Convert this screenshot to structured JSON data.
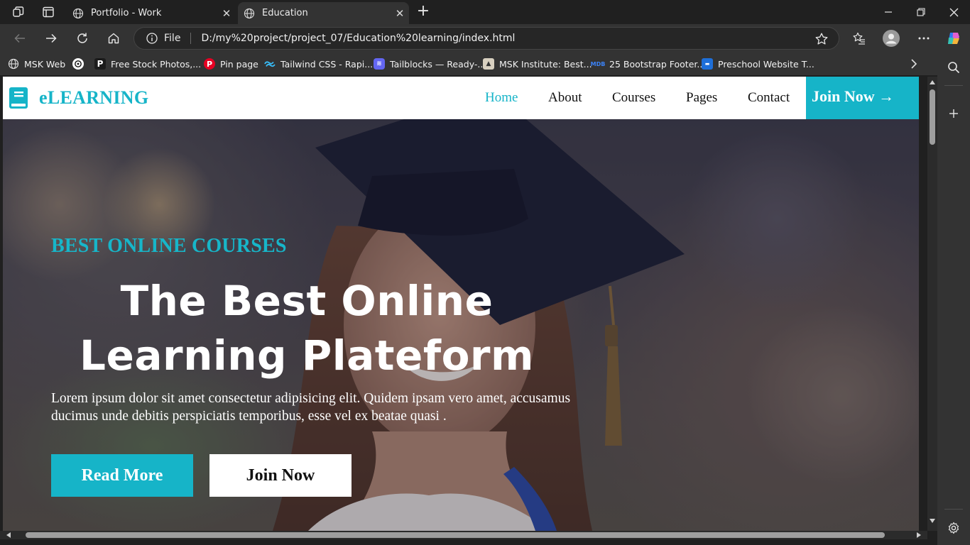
{
  "browser": {
    "tabs": [
      {
        "title": "Portfolio - Work",
        "icon": "globe-icon",
        "active": false
      },
      {
        "title": "Education",
        "icon": "globe-icon",
        "active": true
      }
    ],
    "address": {
      "scheme_label": "File",
      "url": "D:/my%20project/project_07/Education%20learning/index.html"
    },
    "bookmarks": [
      {
        "label": "MSK Web",
        "icon": "globe-icon"
      },
      {
        "label": "",
        "icon": "chatgpt-icon"
      },
      {
        "label": "Free Stock Photos,...",
        "icon": "pexels-icon"
      },
      {
        "label": "Pin page",
        "icon": "pinterest-icon"
      },
      {
        "label": "Tailwind CSS - Rapi...",
        "icon": "tailwind-icon"
      },
      {
        "label": "Tailblocks — Ready-...",
        "icon": "tailblocks-icon"
      },
      {
        "label": "MSK Institute: Best...",
        "icon": "msk-institute-icon"
      },
      {
        "label": "25 Bootstrap Footer...",
        "icon": "mdb-icon"
      },
      {
        "label": "Preschool Website T...",
        "icon": "preschool-icon"
      }
    ]
  },
  "site": {
    "brand": "eLEARNING",
    "nav": {
      "home": "Home",
      "about": "About",
      "courses": "Courses",
      "pages": "Pages",
      "contact": "Contact",
      "join": "Join Now →"
    },
    "hero": {
      "subtitle": "BEST ONLINE COURSES",
      "title_line1": "The Best Online",
      "title_line2": "Learning Plateform",
      "text": "Lorem ipsum dolor sit amet consectetur adipisicing elit. Quidem ipsam vero amet, accusamus ducimus unde debitis perspiciatis temporibus, esse vel ex beatae quasi .",
      "read_more": "Read More",
      "join_now": "Join Now"
    }
  },
  "colors": {
    "accent": "#16b4c8",
    "browser_bg": "#202020",
    "toolbar_bg": "#333333"
  }
}
